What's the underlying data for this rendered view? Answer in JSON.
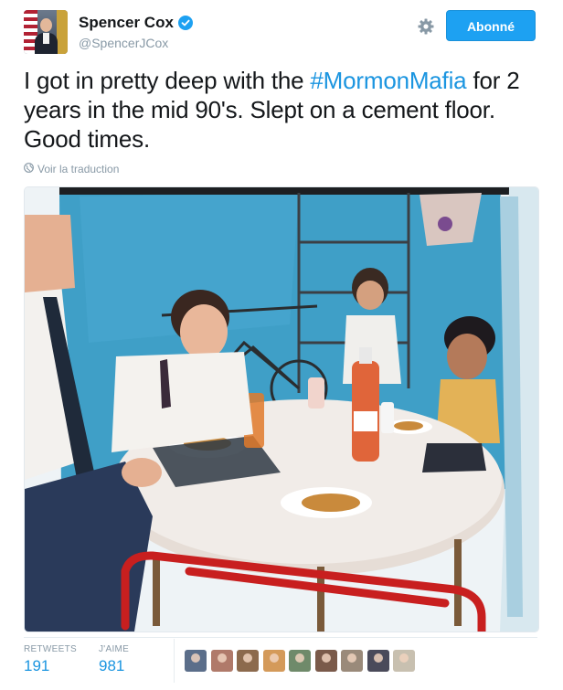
{
  "author": {
    "name": "Spencer Cox",
    "handle": "@SpencerJCox",
    "verified_icon": "verified-badge-icon"
  },
  "actions": {
    "follow_label": "Abonné",
    "settings_icon": "gear-icon"
  },
  "tweet": {
    "text_before": "I got in pretty deep with the ",
    "hashtag": "#MormonMafia",
    "text_after": " for 2 years in the mid 90's. Slept on a cement floor. Good times.",
    "translate_label": "Voir la traduction",
    "translate_icon": "globe-icon"
  },
  "stats": {
    "retweets_label": "RETWEETS",
    "retweets_value": "191",
    "likes_label": "J'AIME",
    "likes_value": "981"
  },
  "likers": [
    {
      "name": "liker-avatar-1",
      "color": "#5b6e8a"
    },
    {
      "name": "liker-avatar-2",
      "color": "#b07a6a"
    },
    {
      "name": "liker-avatar-3",
      "color": "#8c6a4d"
    },
    {
      "name": "liker-avatar-4",
      "color": "#d49a5a"
    },
    {
      "name": "liker-avatar-5",
      "color": "#6f8a6a"
    },
    {
      "name": "liker-avatar-6",
      "color": "#7a5a4a"
    },
    {
      "name": "liker-avatar-7",
      "color": "#9a8a7a"
    },
    {
      "name": "liker-avatar-8",
      "color": "#4a4a5a"
    },
    {
      "name": "liker-avatar-9",
      "color": "#c8c0b0"
    }
  ],
  "colors": {
    "accent": "#1da1f2",
    "link": "#1b95e0",
    "muted": "#8899a6"
  }
}
